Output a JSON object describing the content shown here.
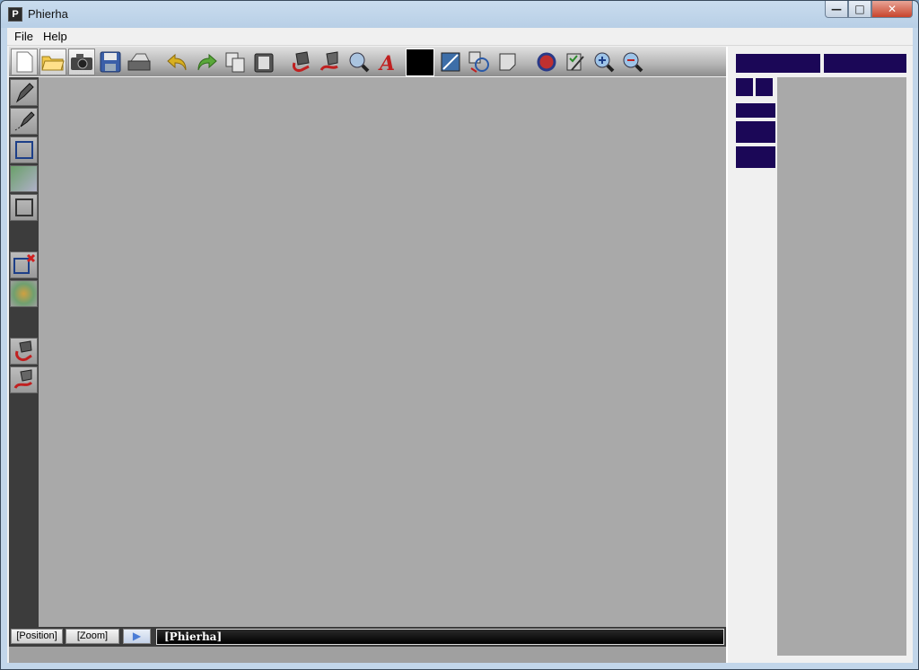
{
  "window": {
    "title": "Phierha",
    "app_icon_glyph": "P"
  },
  "window_buttons": {
    "minimize": "—",
    "maximize": "□",
    "close": "✕"
  },
  "menu": {
    "file": "File",
    "help": "Help"
  },
  "toolbar": {
    "icons": [
      "new-document-icon",
      "open-folder-icon",
      "camera-icon",
      "save-disk-icon",
      "print-icon",
      "undo-icon",
      "redo-icon",
      "copy-icon",
      "paste-icon",
      "paint-bucket-icon",
      "paint-bucket-alt-icon",
      "magnifier-icon",
      "text-a-icon",
      "color-swatch",
      "resize-image-icon",
      "rotate-icon",
      "note-icon",
      "color-sphere-icon",
      "checklist-icon",
      "zoom-in-icon",
      "zoom-out-icon"
    ],
    "current_color": "#000000"
  },
  "left_tools": [
    "pen-tool-icon",
    "pen-dotted-icon",
    "rectangle-select-icon",
    "gradient-icon",
    "rectangle-frame-icon",
    "clear-selection-icon",
    "transparency-icon",
    "fill-bucket-icon",
    "fill-bucket-alt-icon"
  ],
  "status": {
    "position_label": "[Position]",
    "zoom_label": "[Zoom]",
    "play_label": "▶",
    "message": "[Phierha]"
  },
  "colors": {
    "canvas": "#a9a9a9",
    "panel_button": "#1b0757",
    "tool_strip": "#3c3c3c"
  }
}
